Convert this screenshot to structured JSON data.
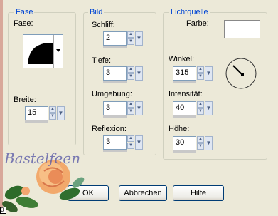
{
  "groups": {
    "fase": {
      "legend": "Fase",
      "fase_label": "Fase:",
      "breite_label": "Breite:",
      "breite_value": "15"
    },
    "bild": {
      "legend": "Bild",
      "schliff_label": "Schliff:",
      "schliff_value": "2",
      "tiefe_label": "Tiefe:",
      "tiefe_value": "3",
      "umgebung_label": "Umgebung:",
      "umgebung_value": "3",
      "reflexion_label": "Reflexion:",
      "reflexion_value": "3"
    },
    "lichtquelle": {
      "legend": "Lichtquelle",
      "farbe_label": "Farbe:",
      "farbe_color": "#ffffff",
      "winkel_label": "Winkel:",
      "winkel_value": "315",
      "intensitaet_label": "Intensität:",
      "intensitaet_value": "40",
      "hoehe_label": "Höhe:",
      "hoehe_value": "30"
    }
  },
  "buttons": {
    "ok": "OK",
    "abbrechen": "Abbrechen",
    "hilfe": "Hilfe"
  },
  "watermark": "Bastelfeen",
  "colors": {
    "accent": "#0046d5",
    "background": "#ece9d8"
  }
}
